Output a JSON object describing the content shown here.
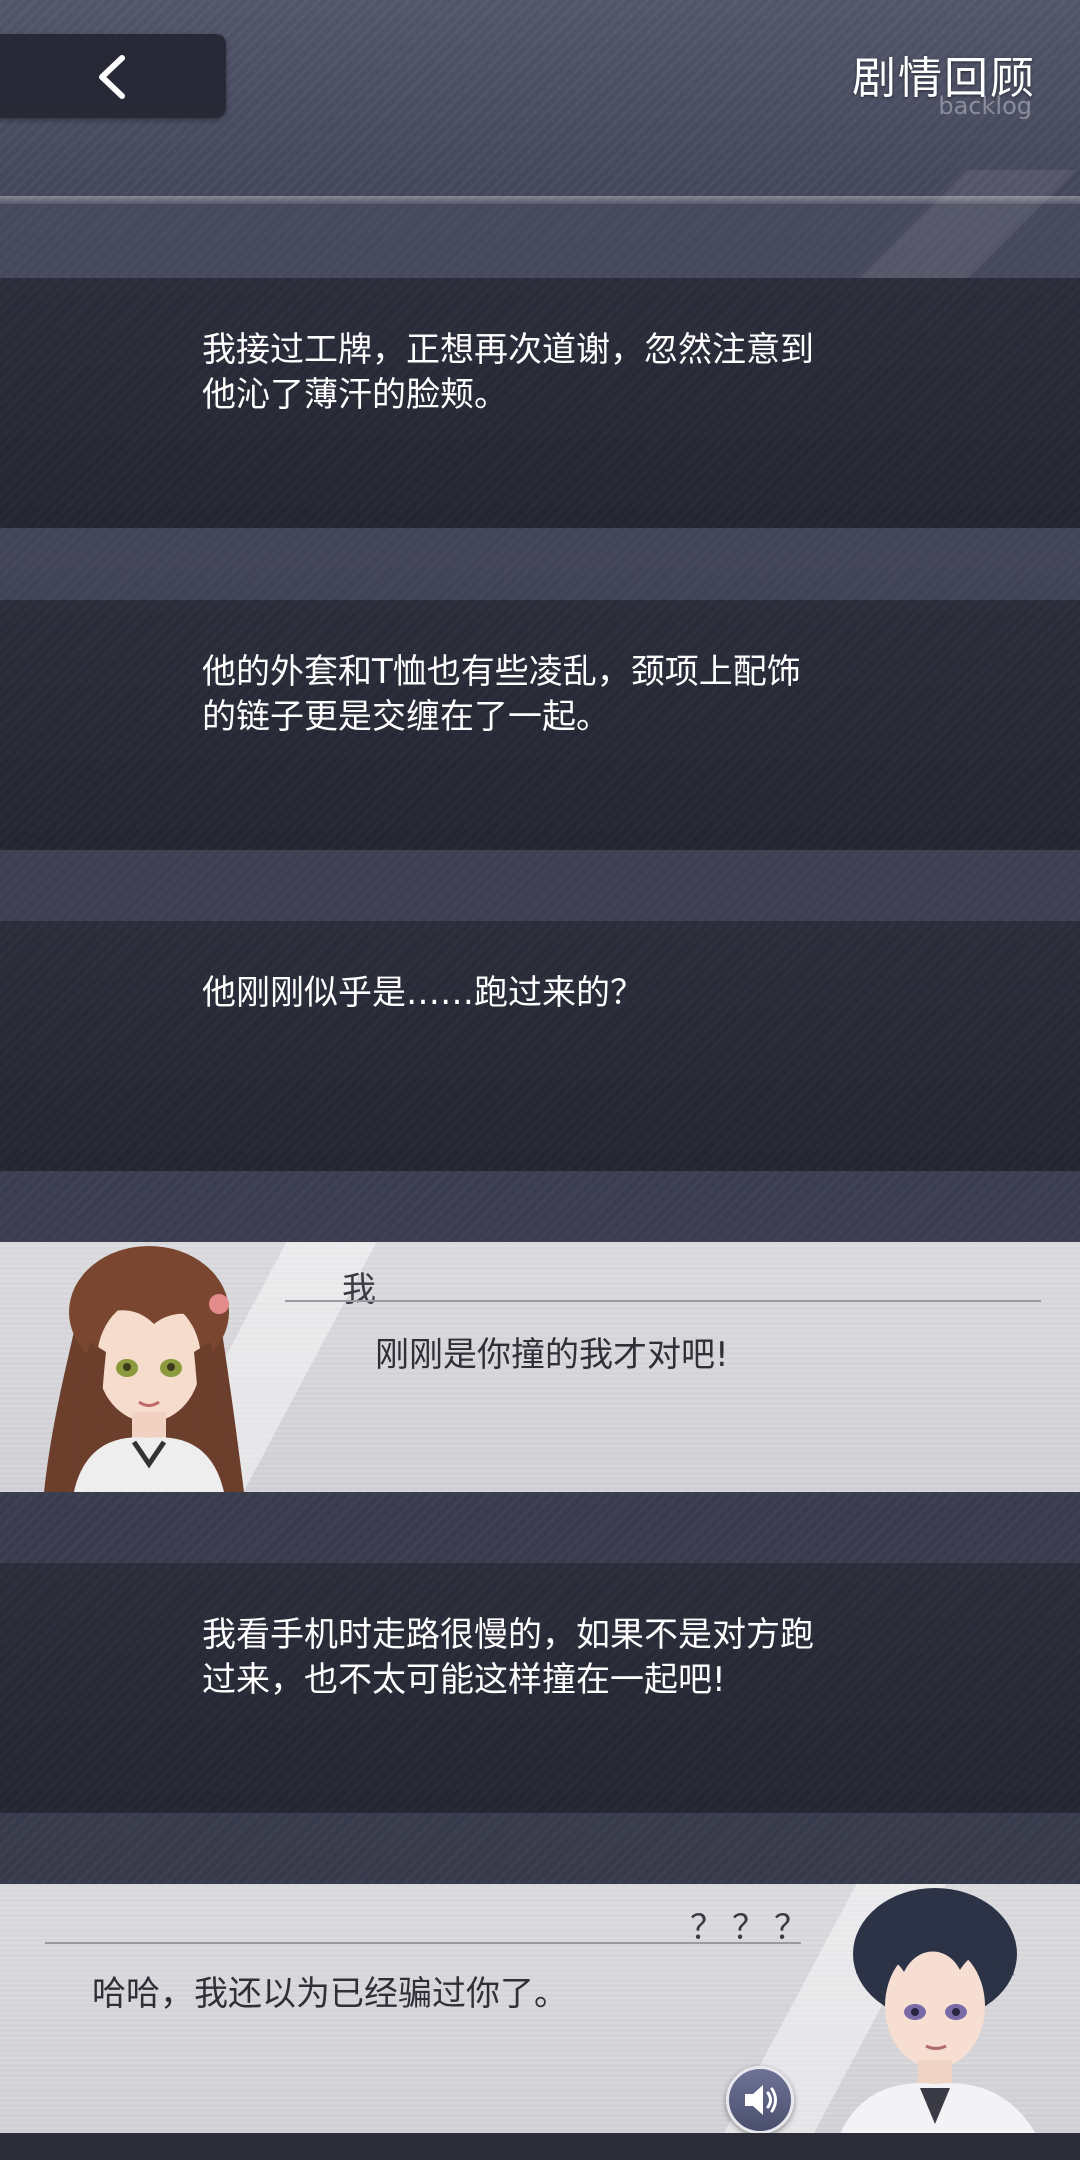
{
  "header": {
    "title": "剧情回顾",
    "subtitle": "backlog",
    "back_icon": "chevron-left-icon"
  },
  "entries": [
    {
      "type": "narration",
      "lines": [
        "我接过工牌，正想再次道谢，忽然注意到",
        "他沁了薄汗的脸颊。"
      ]
    },
    {
      "type": "narration",
      "lines": [
        "他的外套和T恤也有些凌乱，颈项上配饰",
        "的链子更是交缠在了一起。"
      ]
    },
    {
      "type": "narration",
      "lines": [
        "他刚刚似乎是……跑过来的？"
      ]
    },
    {
      "type": "dialogue",
      "speaker": "我",
      "text": "刚刚是你撞的我才对吧!",
      "portrait": "heroine-portrait"
    },
    {
      "type": "narration",
      "lines": [
        "我看手机时走路很慢的，如果不是对方跑",
        "过来，也不太可能这样撞在一起吧!"
      ]
    },
    {
      "type": "dialogue",
      "speaker": "？？？",
      "text": "哈哈，我还以为已经骗过你了。",
      "portrait": "male-portrait",
      "voice_icon": "speaker-icon"
    }
  ],
  "colors": {
    "header_bg": "#4a4d60",
    "narration_bg": "#262834",
    "dialogue_bg": "#d4d4d9",
    "text_light": "#ffffff",
    "text_dark": "#2f2f38"
  }
}
